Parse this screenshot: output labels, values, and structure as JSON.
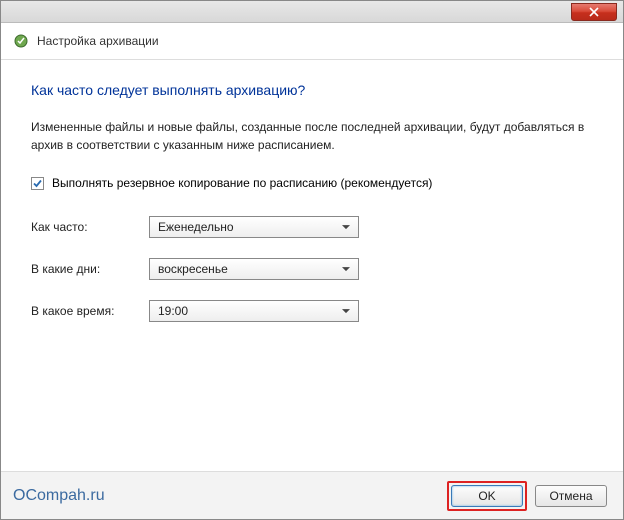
{
  "window": {
    "title": "Настройка архивации"
  },
  "main": {
    "heading": "Как часто следует выполнять архивацию?",
    "description": "Измененные файлы и новые файлы, созданные после последней архивации, будут добавляться в архив в соответствии с указанным ниже расписанием."
  },
  "schedule": {
    "checkbox_label": "Выполнять резервное копирование по расписанию (рекомендуется)",
    "checked": true,
    "frequency_label": "Как часто:",
    "frequency_value": "Еженедельно",
    "day_label": "В какие дни:",
    "day_value": "воскресенье",
    "time_label": "В какое время:",
    "time_value": "19:00"
  },
  "footer": {
    "watermark": "OCompah.ru",
    "ok_label": "OK",
    "cancel_label": "Отмена"
  }
}
